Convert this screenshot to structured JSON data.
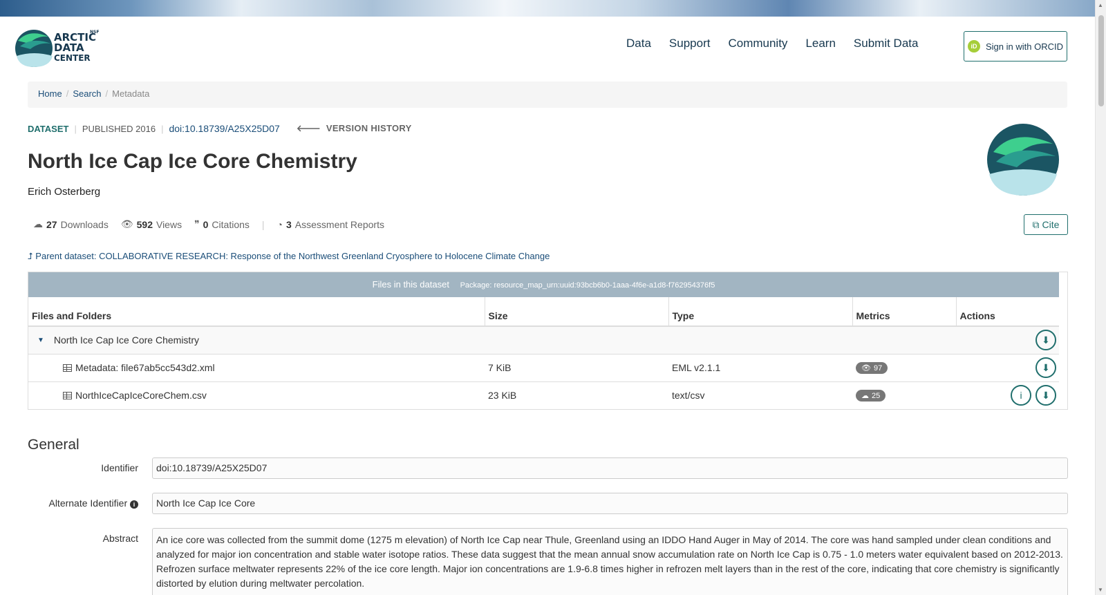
{
  "nav": {
    "items": [
      "Data",
      "Support",
      "Community",
      "Learn",
      "Submit Data"
    ],
    "orcid_label": "Sign in with ORCID"
  },
  "logo": {
    "nsf": "NSF",
    "line1": "ARCTIC",
    "line2": "DATA",
    "line3": "CENTER"
  },
  "breadcrumb": {
    "home": "Home",
    "search": "Search",
    "current": "Metadata"
  },
  "dataset": {
    "type_label": "DATASET",
    "published": "PUBLISHED 2016",
    "doi": "doi:10.18739/A25X25D07",
    "version_history": "VERSION HISTORY",
    "title": "North Ice Cap Ice Core Chemistry",
    "author": "Erich Osterberg"
  },
  "metrics": {
    "downloads_count": "27",
    "downloads_label": "Downloads",
    "views_count": "592",
    "views_label": "Views",
    "citations_count": "0",
    "citations_label": "Citations",
    "reports_count": "3",
    "reports_label": "Assessment Reports"
  },
  "cite_label": "Cite",
  "parent_link": "Parent dataset: COLLABORATIVE RESEARCH: Response of the Northwest Greenland Cryosphere to Holocene Climate Change",
  "files": {
    "heading": "Files in this dataset",
    "package": "Package: resource_map_urn:uuid:93bcb6b0-1aaa-4f6e-a1d8-f762954376f5",
    "columns": [
      "Files and Folders",
      "Size",
      "Type",
      "Metrics",
      "Actions"
    ],
    "folder": "North Ice Cap Ice Core Chemistry",
    "rows": [
      {
        "name": "Metadata: file67ab5cc543d2.xml",
        "size": "7 KiB",
        "type": "EML v2.1.1",
        "metric": "97",
        "metric_icon": "eye-icon"
      },
      {
        "name": "NorthIceCapIceCoreChem.csv",
        "size": "23 KiB",
        "type": "text/csv",
        "metric": "25",
        "metric_icon": "cloud-download-icon"
      }
    ]
  },
  "general": {
    "heading": "General",
    "identifier_label": "Identifier",
    "identifier_value": "doi:10.18739/A25X25D07",
    "alt_label": "Alternate Identifier",
    "alt_value": "North Ice Cap Ice Core",
    "abstract_label": "Abstract",
    "abstract_value": "An ice core was collected from the summit dome (1275 m elevation) of North Ice Cap near Thule, Greenland using an IDDO Hand Auger in May of 2014. The core was hand sampled under clean conditions and analyzed for major ion concentration and stable water isotope ratios. These data suggest that the mean annual snow accumulation rate on North Ice Cap is 0.75 - 1.0 meters water equivalent based on 2012-2013. Refrozen surface meltwater represents 22% of the ice core length. Major ion concentrations are 1.9-6.8 times higher in refrozen melt layers than in the rest of the core, indicating that core chemistry is significantly distorted by elution during meltwater percolation."
  },
  "colors": {
    "accent": "#1f6e6c",
    "link": "#1a4d78",
    "navy": "#17384f",
    "files_header": "#a2b5c2"
  }
}
